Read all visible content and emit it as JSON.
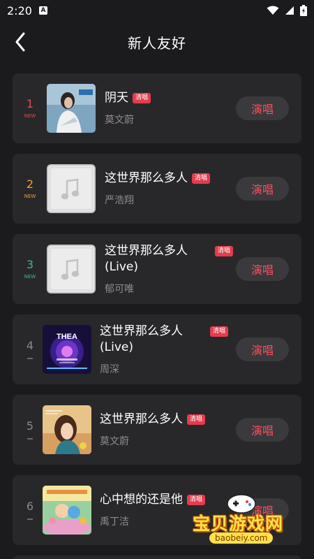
{
  "status_bar": {
    "time": "2:20",
    "notification_badge": "A"
  },
  "header": {
    "title": "新人友好"
  },
  "songs": [
    {
      "rank": "1",
      "rank_label": "NEW",
      "rank_color": "#e04a55",
      "title_line1": "阴天",
      "title_line2": "",
      "tag": "清唱",
      "artist": "莫文蔚",
      "button": "演唱",
      "cover": "photo-woman"
    },
    {
      "rank": "2",
      "rank_label": "NEW",
      "rank_color": "#f0a030",
      "title_line1": "这世界那么多人",
      "title_line2": "",
      "tag": "清唱",
      "artist": "严浩翔",
      "button": "演唱",
      "cover": "music-note-placeholder"
    },
    {
      "rank": "3",
      "rank_label": "NEW",
      "rank_color": "#38c07a",
      "title_line1": "这世界那么多人",
      "title_line2": "(Live)",
      "tag": "清唱",
      "artist": "郁可唯",
      "button": "演唱",
      "cover": "music-note-placeholder"
    },
    {
      "rank": "4",
      "rank_label": "",
      "rank_color": "#8a8a8a",
      "title_line1": "这世界那么多人",
      "title_line2": "(Live)",
      "tag": "清唱",
      "artist": "周深",
      "button": "演唱",
      "cover": "concert-poster",
      "cover_text": "THEA"
    },
    {
      "rank": "5",
      "rank_label": "",
      "rank_color": "#8a8a8a",
      "title_line1": "这世界那么多人",
      "title_line2": "",
      "tag": "清唱",
      "artist": "莫文蔚",
      "button": "演唱",
      "cover": "illustration-girl"
    },
    {
      "rank": "6",
      "rank_label": "",
      "rank_color": "#8a8a8a",
      "title_line1": "心中想的还是他",
      "title_line2": "",
      "tag": "清唱",
      "artist": "禹丁洁",
      "button": "演唱",
      "cover": "illustration-cartoon"
    }
  ],
  "watermark": {
    "text": "宝贝游戏网",
    "url": "baobeiy.com"
  }
}
